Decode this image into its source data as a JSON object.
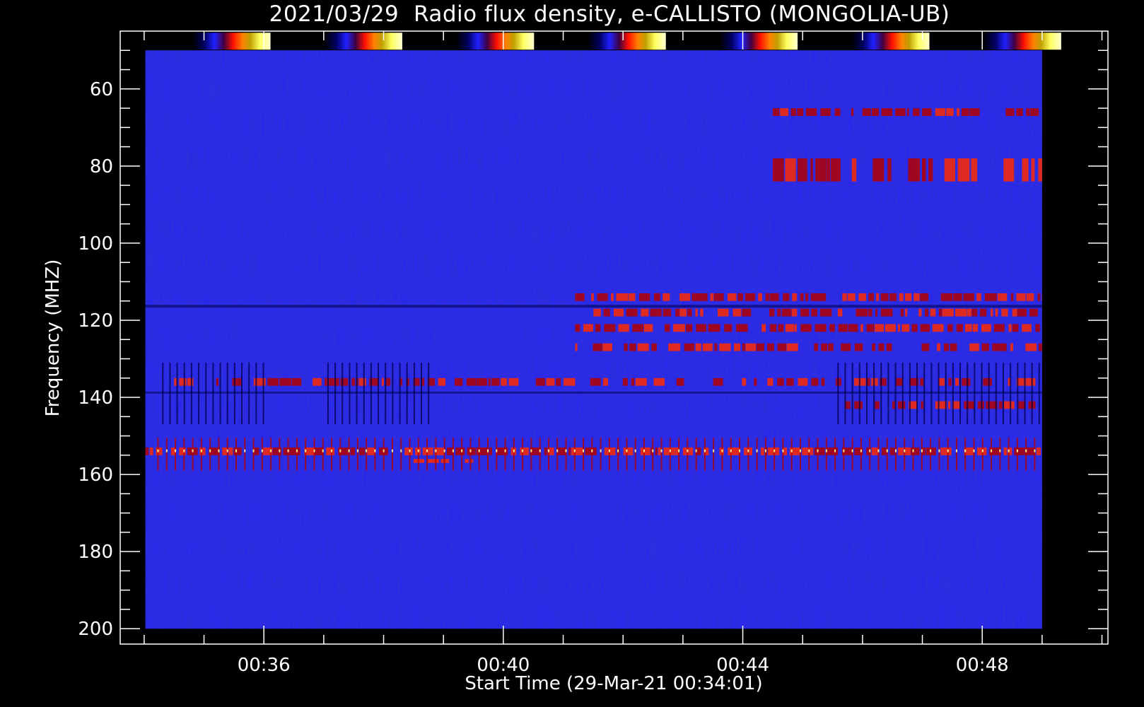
{
  "chart_data": {
    "type": "heatmap",
    "title": "2021/03/29  Radio flux density, e-CALLISTO (MONGOLIA-UB)",
    "xlabel": "Start Time (29-Mar-21 00:34:01)",
    "ylabel": "Frequency (MHZ)",
    "x_ticks": [
      "00:36",
      "00:40",
      "00:44",
      "00:48"
    ],
    "x_tick_minutes": [
      36,
      40,
      44,
      48
    ],
    "x_range_minutes": [
      33.6,
      50.1
    ],
    "x_data_range_minutes": [
      34.02,
      49.0
    ],
    "y_ticks": [
      60,
      80,
      100,
      120,
      140,
      160,
      180,
      200
    ],
    "y_range": [
      45,
      204
    ],
    "y_data_range": [
      50,
      200
    ],
    "y_inverted": true,
    "colorbar_count": 7,
    "colors": {
      "background": "#000000",
      "base": "#2626f2",
      "low": "#00004a",
      "mid": "#b40000",
      "high": "#ff2a00",
      "peak": "#ffff9a"
    },
    "features": [
      {
        "freq_band": [
          113,
          115
        ],
        "time_start": 41.2,
        "time_end": 49.0,
        "intensity": 0.85
      },
      {
        "freq_band": [
          117,
          119
        ],
        "time_start": 41.2,
        "time_end": 49.0,
        "intensity": 0.9
      },
      {
        "freq_band": [
          121,
          123
        ],
        "time_start": 41.2,
        "time_end": 49.0,
        "intensity": 0.8
      },
      {
        "freq_band": [
          126,
          128
        ],
        "time_start": 41.2,
        "time_end": 49.0,
        "intensity": 0.7
      },
      {
        "freq_band": [
          65,
          67
        ],
        "time_start": 44.5,
        "time_end": 49.0,
        "intensity": 0.6
      },
      {
        "freq_band": [
          78,
          84
        ],
        "time_start": 44.5,
        "time_end": 49.0,
        "intensity": 0.55
      },
      {
        "freq_band": [
          153,
          155
        ],
        "time_start": 34.02,
        "time_end": 49.0,
        "intensity": 0.95
      },
      {
        "freq_band": [
          135,
          137
        ],
        "time_start": 34.5,
        "time_end": 48.9,
        "intensity": 0.7
      },
      {
        "freq_band": [
          141,
          143
        ],
        "time_start": 45.7,
        "time_end": 48.9,
        "intensity": 0.75
      },
      {
        "freq_band": [
          156,
          157
        ],
        "time_start": 38.5,
        "time_end": 39.5,
        "intensity": 0.9
      }
    ]
  }
}
